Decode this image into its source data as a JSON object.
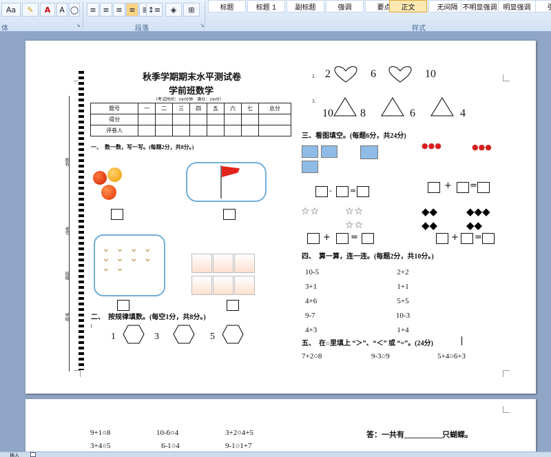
{
  "ribbon": {
    "font_btn": "Aa",
    "groups": {
      "font": "体",
      "paragraph": "段落",
      "styles": "样式"
    },
    "styles": [
      "标题",
      "标题 1",
      "副标题",
      "强调",
      "要点",
      "正文",
      "无间隔",
      "不明显强调",
      "明显强调",
      "引用"
    ]
  },
  "page1": {
    "title": "秋季学期期末水平测试卷",
    "subtitle": "学前班数学",
    "exam_info": "（考试时间：100分钟　满分：100分）",
    "table": {
      "headers": [
        "题号",
        "一",
        "二",
        "三",
        "四",
        "五",
        "六",
        "七",
        "总分"
      ],
      "rows": [
        [
          "得分",
          "",
          "",
          "",
          "",
          "",
          "",
          "",
          ""
        ],
        [
          "评卷人",
          "",
          "",
          "",
          "",
          "",
          "",
          "",
          ""
        ]
      ]
    },
    "margin_labels": [
      "姓名",
      "考号",
      "班级",
      "学校"
    ],
    "section1": "一、　数一数，写一写。(每题2分，共8分。)",
    "section2": "二、　按规律填数。(每空1分，共8分。)",
    "section2_q1": {
      "num": "1",
      "items": [
        "1",
        "3",
        "5"
      ]
    },
    "right": {
      "q2": {
        "num": "2.",
        "items": [
          "2",
          "6",
          "10"
        ]
      },
      "q3": {
        "num": "3.",
        "items": [
          "10",
          "8",
          "6",
          "4"
        ]
      },
      "section3": "三、看图填空。(每题6分，共24分)",
      "eq_ops": {
        "minus": "-",
        "eq": "=",
        "plus": "+"
      },
      "section4": "四、　算一算，连一连。(每题2分，共10分。)",
      "left_exprs": [
        "10-5",
        "3+1",
        "4+6",
        "9-7",
        "4+3"
      ],
      "right_exprs": [
        "2+2",
        "1+1",
        "5+5",
        "10-3",
        "1+4"
      ],
      "section5": "五、　在○里填上 “＞”、“＜” 或 “=”。(24分)",
      "compare": [
        "7+2○8",
        "9-3○9",
        "5+4○6+3"
      ]
    }
  },
  "page2": {
    "compare": [
      "9+1○8",
      "10-6○4",
      "3+2○4+5",
      "3+4○5",
      "6-1○4",
      "9-1○1+7"
    ],
    "answer": "答：一共有＿＿＿＿＿只蝴蝶。"
  },
  "status": {
    "insert": "插入"
  }
}
